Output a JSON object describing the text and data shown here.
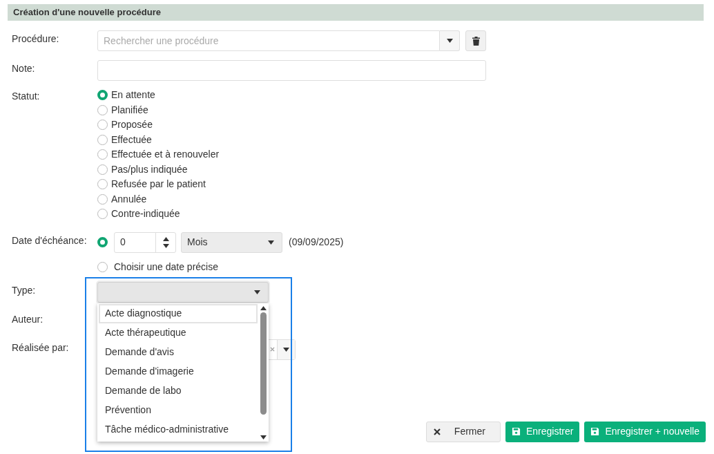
{
  "header": {
    "title": "Création d'une nouvelle procédure"
  },
  "procedure": {
    "label": "Procédure:",
    "placeholder": "Rechercher une procédure"
  },
  "note": {
    "label": "Note:"
  },
  "status": {
    "label": "Statut:",
    "options": [
      {
        "label": "En attente",
        "selected": true
      },
      {
        "label": "Planifiée",
        "selected": false
      },
      {
        "label": "Proposée",
        "selected": false
      },
      {
        "label": "Effectuée",
        "selected": false
      },
      {
        "label": "Effectuée et à renouveler",
        "selected": false
      },
      {
        "label": "Pas/plus indiquée",
        "selected": false
      },
      {
        "label": "Refusée par le patient",
        "selected": false
      },
      {
        "label": "Annulée",
        "selected": false
      },
      {
        "label": "Contre-indiquée",
        "selected": false
      }
    ]
  },
  "due_date": {
    "label": "Date d'échéance:",
    "options": [
      {
        "kind": "relative",
        "selected": true,
        "value": "0",
        "unit": "Mois",
        "computed": "(09/09/2025)"
      },
      {
        "kind": "precise",
        "selected": false,
        "label": "Choisir une date précise"
      }
    ]
  },
  "type": {
    "label": "Type:",
    "expanded": true,
    "options": [
      {
        "label": "Acte diagnostique",
        "highlighted": true
      },
      {
        "label": "Acte thérapeutique",
        "highlighted": false
      },
      {
        "label": "Demande d'avis",
        "highlighted": false
      },
      {
        "label": "Demande d'imagerie",
        "highlighted": false
      },
      {
        "label": "Demande de labo",
        "highlighted": false
      },
      {
        "label": "Prévention",
        "highlighted": false
      },
      {
        "label": "Tâche médico-administrative",
        "highlighted": false
      }
    ]
  },
  "author": {
    "label": "Auteur:"
  },
  "performed_by": {
    "label": "Réalisée par:"
  },
  "buttons": [
    {
      "kind": "close",
      "label": "Fermer"
    },
    {
      "kind": "save",
      "label": "Enregistrer"
    },
    {
      "kind": "save_new",
      "label": "Enregistrer + nouvelle"
    }
  ]
}
